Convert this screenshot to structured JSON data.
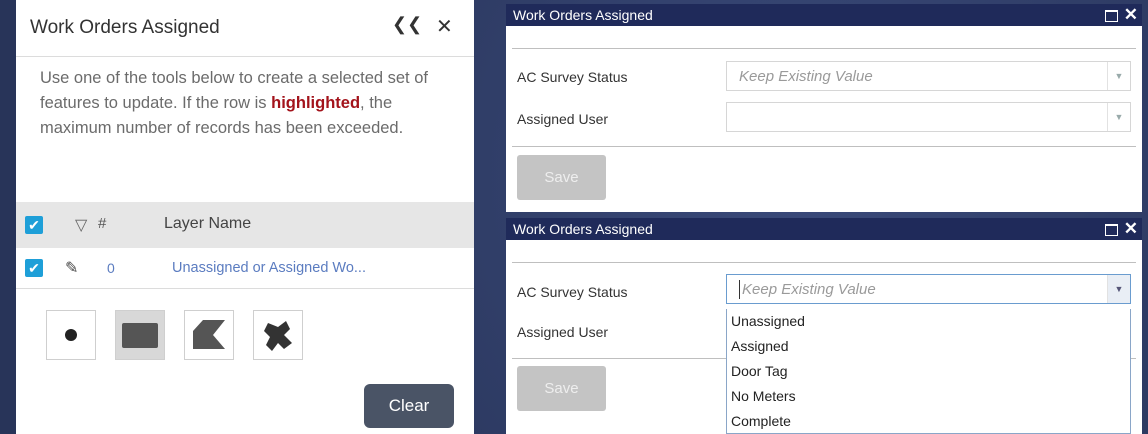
{
  "left_panel": {
    "title": "Work Orders Assigned",
    "description_before": "Use one of the tools below to create a selected set of features to update. If the row is ",
    "description_highlight": "highlighted",
    "description_after": ", the maximum number of records has been exceeded.",
    "table": {
      "header_hash": "#",
      "header_name": "Layer Name",
      "row": {
        "count": "0",
        "name": "Unassigned or Assigned Wo..."
      }
    },
    "tools": [
      "point-tool",
      "rectangle-tool",
      "polygon-tool",
      "freehand-tool"
    ],
    "clear_label": "Clear"
  },
  "dialog_top": {
    "title": "Work Orders Assigned",
    "fields": [
      {
        "label": "AC Survey Status",
        "placeholder": "Keep Existing Value"
      },
      {
        "label": "Assigned User",
        "placeholder": ""
      }
    ],
    "save_label": "Save"
  },
  "dialog_bottom": {
    "title": "Work Orders Assigned",
    "fields": [
      {
        "label": "AC Survey Status",
        "placeholder": "Keep Existing Value"
      },
      {
        "label": "Assigned User",
        "placeholder": ""
      }
    ],
    "save_label": "Save",
    "dropdown_options": [
      "Unassigned",
      "Assigned",
      "Door Tag",
      "No Meters",
      "Complete"
    ]
  },
  "colors": {
    "accent": "#1e9fd8",
    "highlight": "#a3131b",
    "titlebar": "#1f2a5a",
    "clear_button": "#4a5466"
  }
}
